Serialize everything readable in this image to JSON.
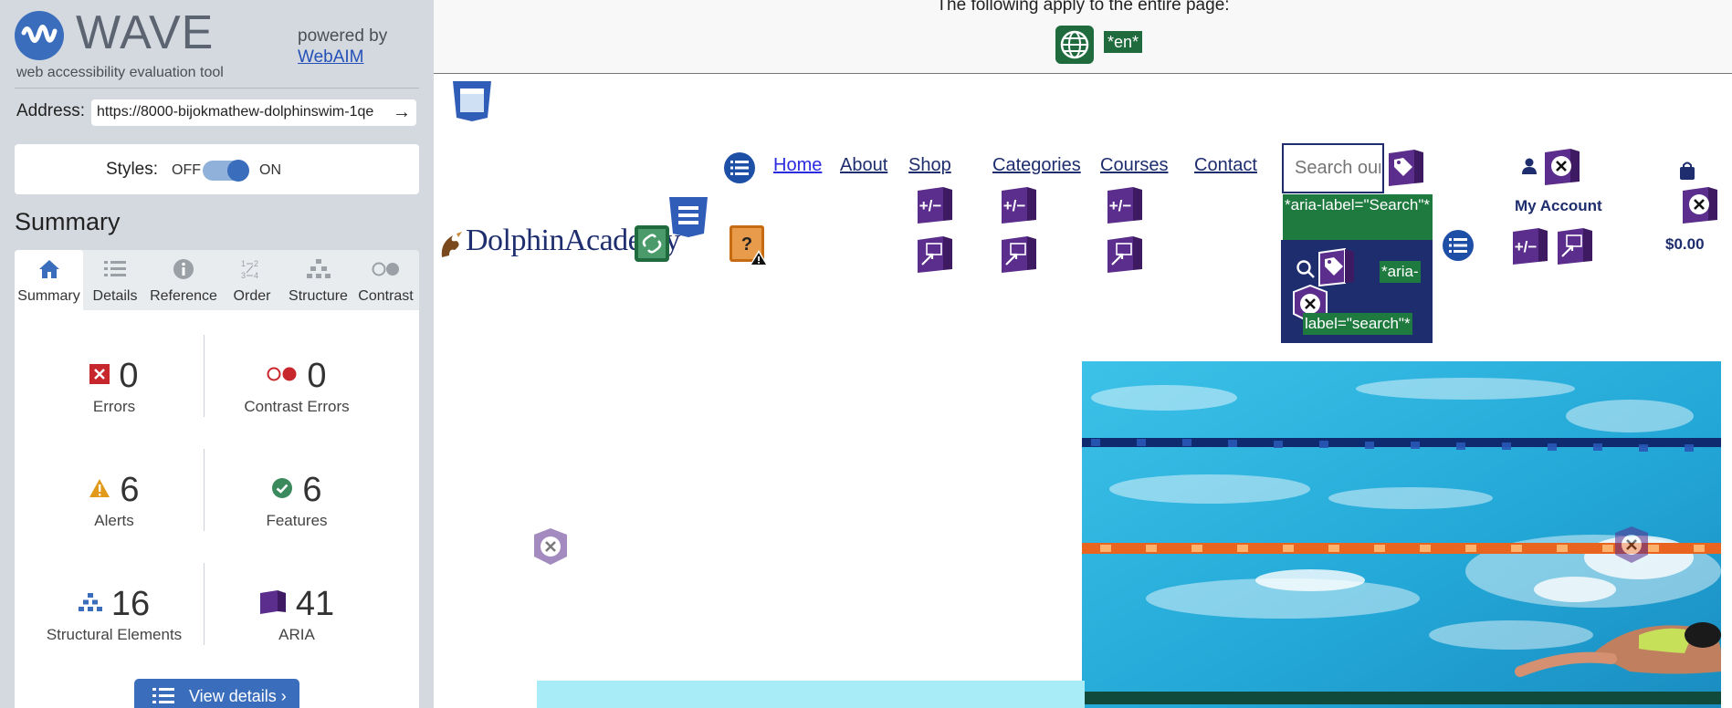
{
  "wave": {
    "title": "WAVE",
    "subtitle": "web accessibility evaluation tool",
    "powered_by": "powered by",
    "webaim_link": "WebAIM",
    "address_label": "Address:",
    "address_value": "https://8000-bijokmathew-dolphinswim-1qe",
    "address_go": "→",
    "styles_label": "Styles:",
    "styles_off": "OFF",
    "styles_on": "ON",
    "summary_title": "Summary",
    "tabs": [
      {
        "label": "Summary",
        "icon": "home-icon",
        "active": true
      },
      {
        "label": "Details",
        "icon": "list-icon"
      },
      {
        "label": "Reference",
        "icon": "info-icon"
      },
      {
        "label": "Order",
        "icon": "order-icon"
      },
      {
        "label": "Structure",
        "icon": "structure-icon"
      },
      {
        "label": "Contrast",
        "icon": "contrast-icon"
      }
    ],
    "stats": {
      "errors": {
        "count": "0",
        "label": "Errors"
      },
      "contrast_errors": {
        "count": "0",
        "label": "Contrast Errors"
      },
      "alerts": {
        "count": "6",
        "label": "Alerts"
      },
      "features": {
        "count": "6",
        "label": "Features"
      },
      "structural": {
        "count": "16",
        "label": "Structural Elements"
      },
      "aria": {
        "count": "41",
        "label": "ARIA"
      }
    },
    "view_details": "View details ›",
    "colors": {
      "accent": "#3a6ebd",
      "error": "#c8262d",
      "alert": "#e29a1a",
      "feature": "#3a8a5e",
      "aria": "#5b2d8c"
    }
  },
  "preview": {
    "banner_text": "The following apply to the entire page:",
    "lang_badge": "*en*",
    "nav": {
      "home": "Home",
      "about": "About",
      "shop": "Shop",
      "categories": "Categories",
      "courses": "Courses",
      "contact": "Contact"
    },
    "search_placeholder": "Search our site",
    "aria_label_search_1": "*aria-label=\"Search\"*",
    "aria_label_search_2a": "*aria-",
    "aria_label_search_2b": "label=\"search\"*",
    "logo": "DolphinAcademy",
    "my_account": "My Account",
    "cart_total": "$0.00",
    "wave_icon_plusminus": "+/−"
  }
}
